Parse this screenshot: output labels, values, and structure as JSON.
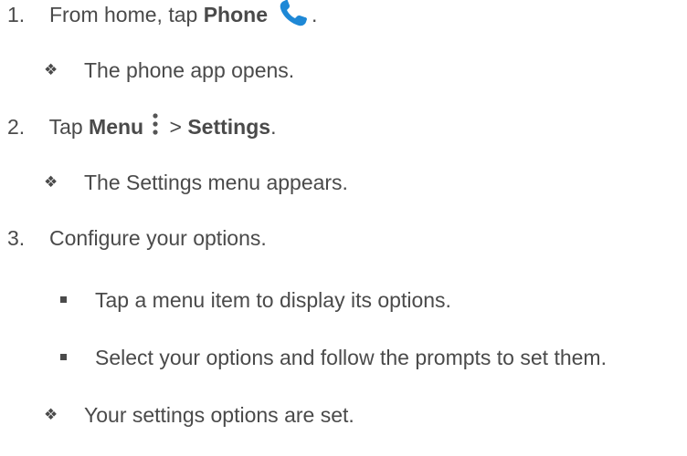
{
  "steps": [
    {
      "number": "1.",
      "text_pre": "From home, tap ",
      "bold": "Phone",
      "icon": "phone-icon",
      "text_post": "."
    },
    {
      "result": "The phone app opens."
    },
    {
      "number": "2.",
      "text_pre": "Tap ",
      "bold": "Menu",
      "icon": "more-vertical-icon",
      "text_mid": " > ",
      "bold2": "Settings",
      "text_post": "."
    },
    {
      "result": "The Settings menu appears."
    },
    {
      "number": "3.",
      "text": "Configure your options."
    },
    {
      "bullets": [
        "Tap a menu item to display its options.",
        "Select your options and follow the prompts to set them."
      ]
    },
    {
      "result": "Your settings options are set."
    }
  ],
  "colors": {
    "text": "#4a4a4a",
    "phone_icon": "#1e88d6"
  }
}
